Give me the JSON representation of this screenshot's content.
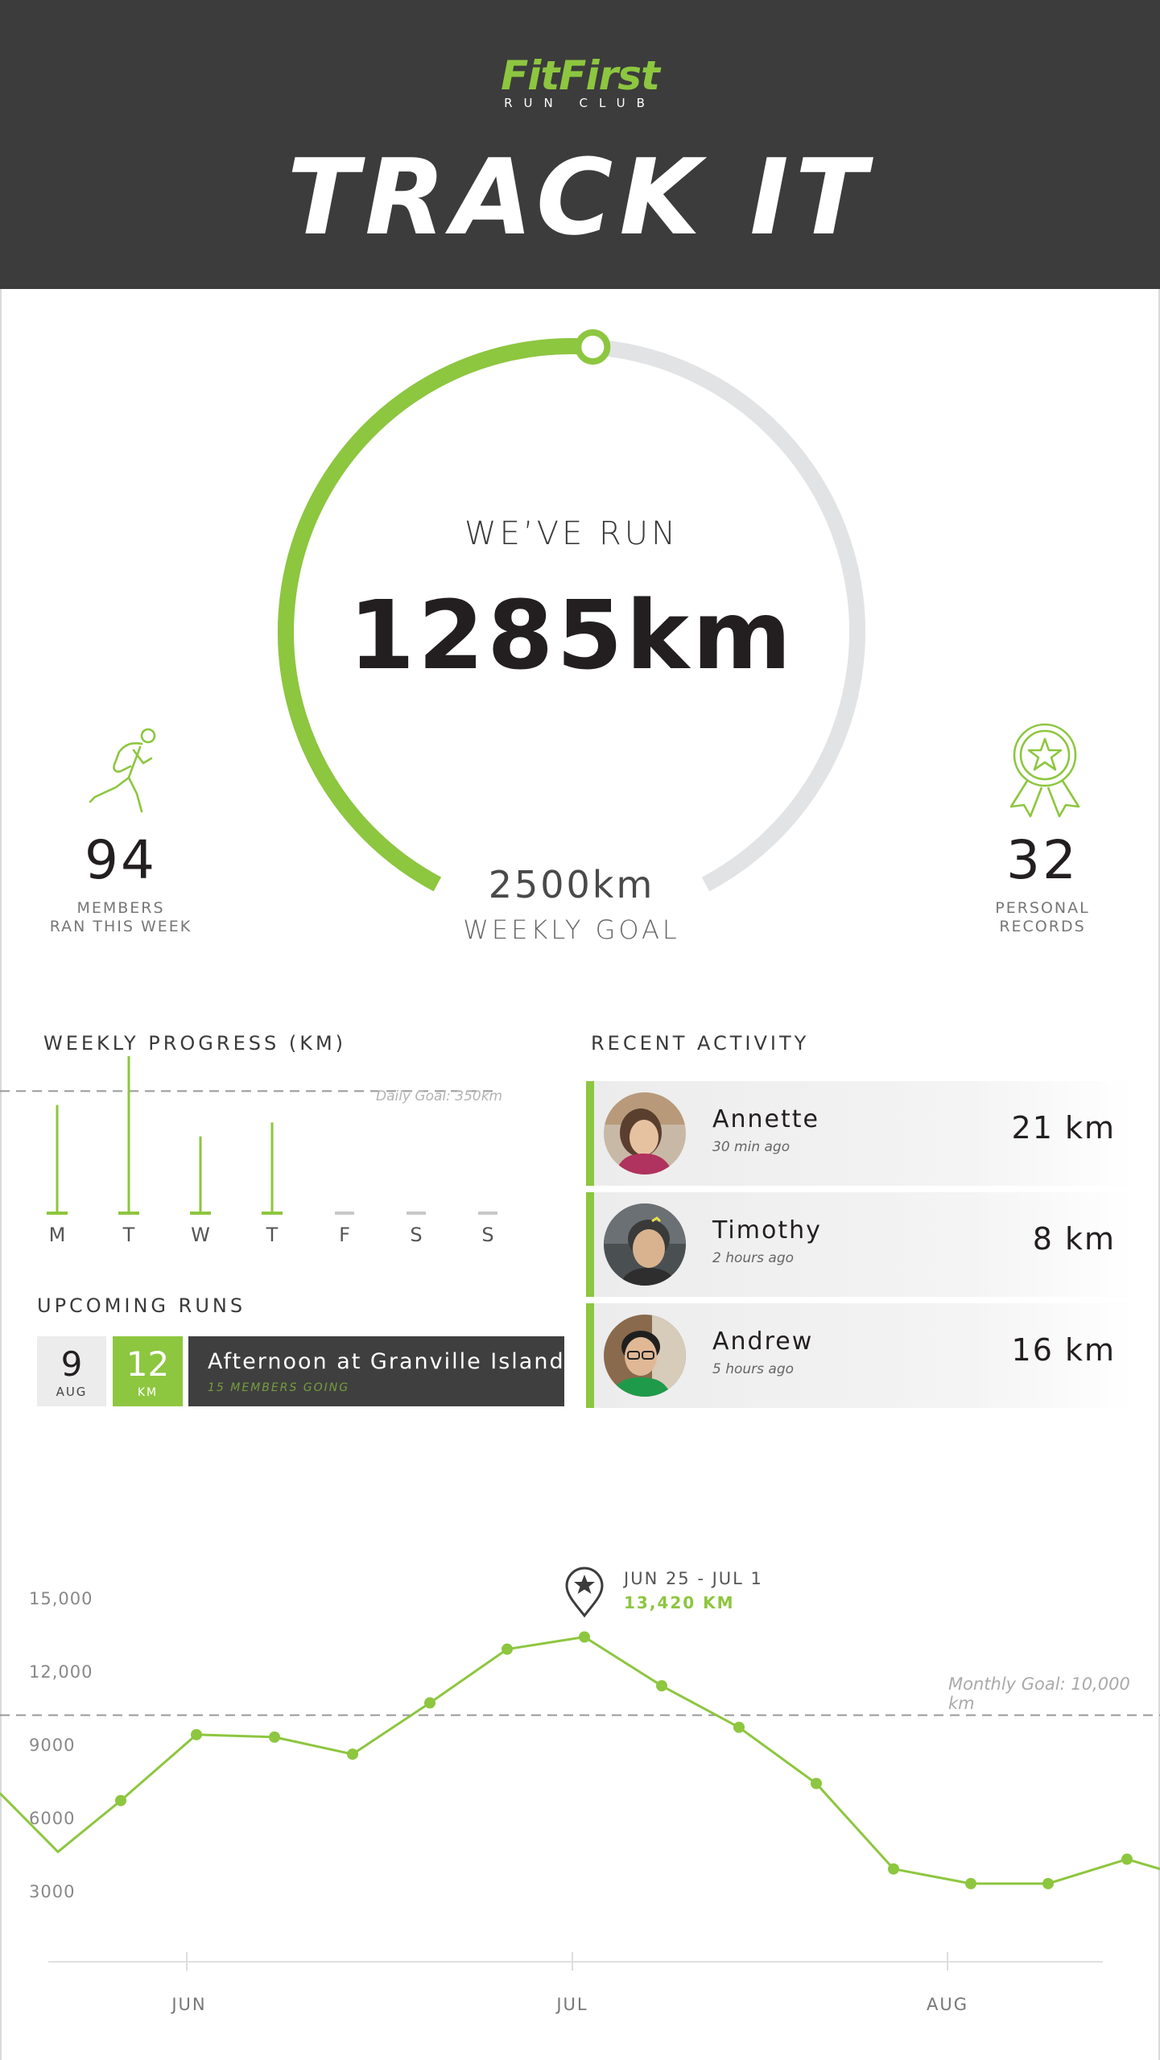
{
  "header": {
    "logo": "FitFirst",
    "logo_sub": "RUN CLUB",
    "title": "TRACK IT"
  },
  "progress": {
    "label": "WE’VE RUN",
    "total": "1285km",
    "goal_value": "2500km",
    "goal_label": "WEEKLY GOAL",
    "fraction": 0.514
  },
  "stats": {
    "members": {
      "value": "94",
      "label_line1": "MEMBERS",
      "label_line2": "RAN THIS WEEK",
      "icon": "runner-icon"
    },
    "records": {
      "value": "32",
      "label_line1": "PERSONAL",
      "label_line2": "RECORDS",
      "icon": "award-ribbon-icon"
    }
  },
  "weekly": {
    "title": "WEEKLY PROGRESS (KM)",
    "goal_label": "Daily Goal: 350km",
    "goal_value": 350,
    "days": [
      {
        "label": "M",
        "value": 310
      },
      {
        "label": "T",
        "value": 450
      },
      {
        "label": "W",
        "value": 220
      },
      {
        "label": "T",
        "value": 260
      },
      {
        "label": "F",
        "value": 0
      },
      {
        "label": "S",
        "value": 0
      },
      {
        "label": "S",
        "value": 0
      }
    ]
  },
  "upcoming": {
    "title": "UPCOMING RUNS",
    "runs": [
      {
        "day": "9",
        "month": "AUG",
        "km": "12",
        "km_unit": "KM",
        "name": "Afternoon at Granville Island",
        "going": "15 MEMBERS GOING"
      }
    ]
  },
  "activity": {
    "title": "RECENT ACTIVITY",
    "items": [
      {
        "name": "Annette",
        "time": "30 min ago",
        "km": "21 km"
      },
      {
        "name": "Timothy",
        "time": "2 hours ago",
        "km": "8 km"
      },
      {
        "name": "Andrew",
        "time": "5  hours ago",
        "km": "16 km"
      }
    ]
  },
  "chart_data": {
    "type": "line",
    "ylim": [
      0,
      15000
    ],
    "yticks": [
      "15,000",
      "12,000",
      "9000",
      "6000",
      "3000"
    ],
    "x_labels": [
      "JUN",
      "JUL",
      "AUG"
    ],
    "goal_label": "Monthly Goal: 10,000 km",
    "goal_value": 10300,
    "series": [
      {
        "values": [
          7100,
          4700,
          6800,
          9500,
          9400,
          8700,
          10800,
          13000,
          13500,
          11500,
          9800,
          7500,
          4000,
          3400,
          3400,
          4400,
          4000
        ]
      }
    ],
    "highlight": {
      "date": "JUN 25 - JUL 1",
      "value": "13,420 KM"
    },
    "colors": {
      "line": "#8dc63f",
      "goal": "#999999",
      "axis": "#dddddd"
    }
  },
  "colors": {
    "accent": "#8dc63f",
    "dark": "#3c3c3c",
    "ring_bg": "#e2e3e4"
  }
}
